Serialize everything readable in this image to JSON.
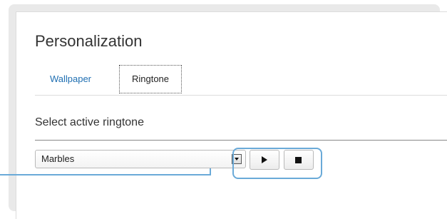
{
  "page": {
    "title": "Personalization"
  },
  "tabs": [
    {
      "label": "Wallpaper",
      "active": false
    },
    {
      "label": "Ringtone",
      "active": true
    }
  ],
  "ringtone": {
    "section_label": "Select active ringtone",
    "selected": "Marbles"
  },
  "controls": {
    "play_icon": "play-icon",
    "stop_icon": "stop-icon"
  },
  "colors": {
    "link": "#1f6fb2",
    "highlight": "#6aaad8"
  }
}
